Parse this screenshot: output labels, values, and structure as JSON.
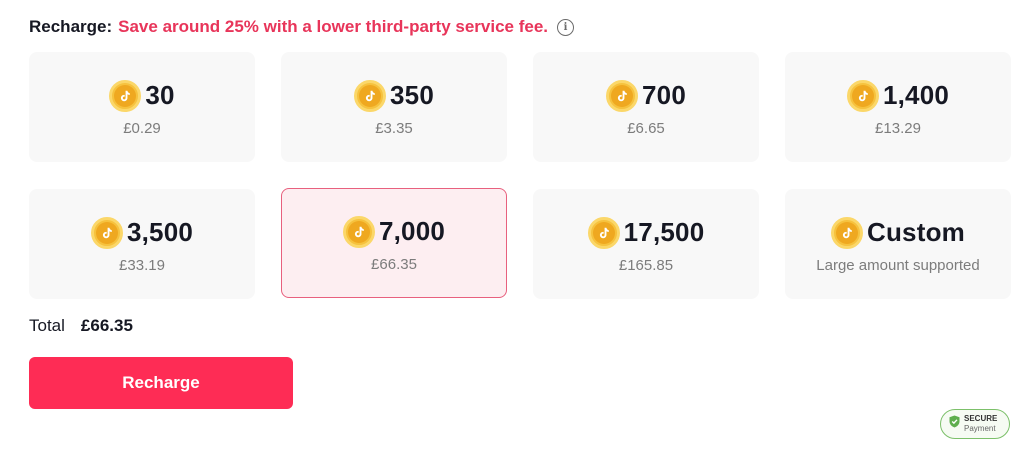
{
  "header": {
    "label": "Recharge:",
    "promo": "Save around 25% with a lower third-party service fee.",
    "info_icon": "info-icon"
  },
  "packages": [
    {
      "coins": "30",
      "price": "£0.29",
      "selected": false
    },
    {
      "coins": "350",
      "price": "£3.35",
      "selected": false
    },
    {
      "coins": "700",
      "price": "£6.65",
      "selected": false
    },
    {
      "coins": "1,400",
      "price": "£13.29",
      "selected": false
    },
    {
      "coins": "3,500",
      "price": "£33.19",
      "selected": false
    },
    {
      "coins": "7,000",
      "price": "£66.35",
      "selected": true
    },
    {
      "coins": "17,500",
      "price": "£165.85",
      "selected": false
    },
    {
      "coins": "Custom",
      "price": "Large amount supported",
      "selected": false
    }
  ],
  "total": {
    "label": "Total",
    "value": "£66.35"
  },
  "recharge_button": {
    "label": "Recharge"
  },
  "secure_badge": {
    "line1": "SECURE",
    "line2": "Payment",
    "icon": "shield-check-icon"
  },
  "colors": {
    "accent": "#fe2c55",
    "promo_text": "#e8355a",
    "selected_bg": "#fdeef1",
    "selected_border": "#e8607e",
    "coin": "#f6c23e",
    "secure_green": "#7cc06a"
  }
}
